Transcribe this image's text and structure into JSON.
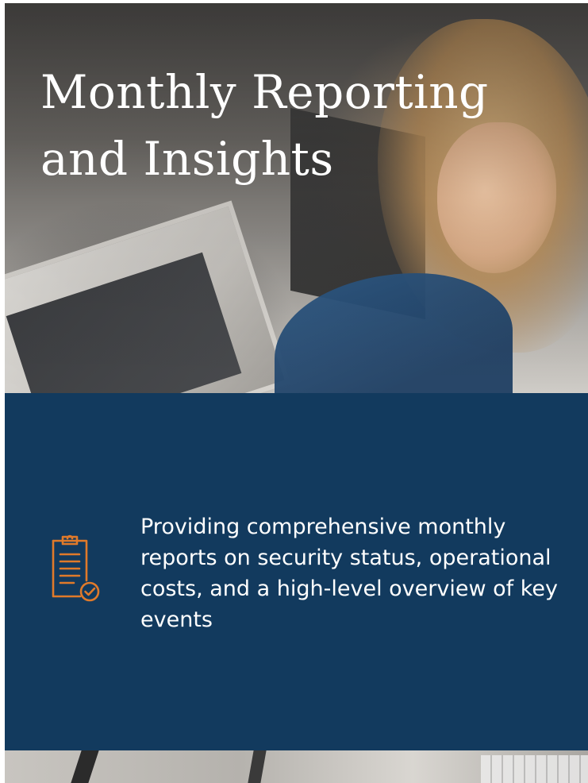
{
  "hero": {
    "title_line1": "Monthly Reporting",
    "title_line2": "and Insights"
  },
  "info": {
    "icon": "clipboard-check-icon",
    "description": "Providing comprehensive monthly reports on security status, operational costs, and a high-level overview of key events"
  },
  "colors": {
    "panel_background": "#123a5e",
    "icon_accent": "#e07a2a",
    "text": "#ffffff"
  }
}
